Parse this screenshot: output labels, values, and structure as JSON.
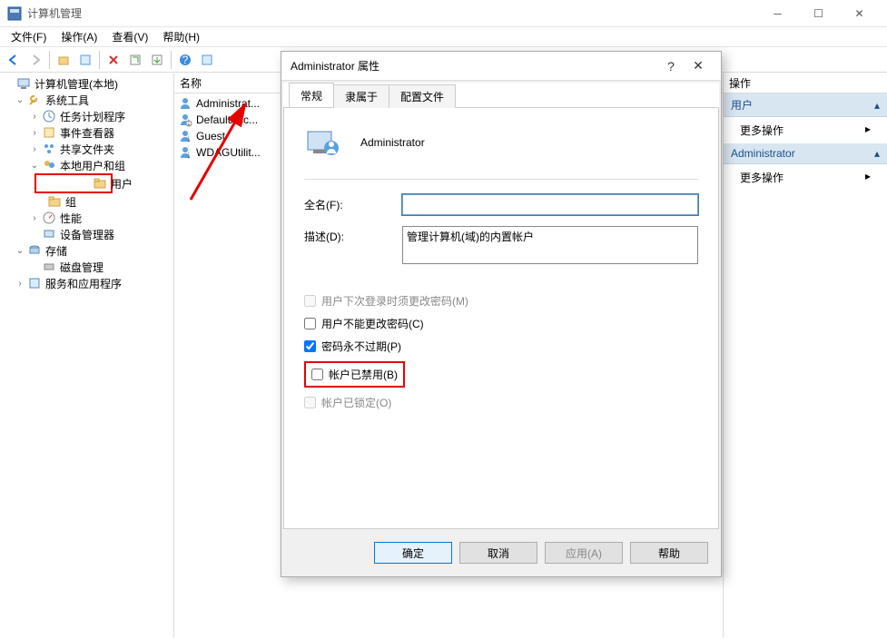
{
  "window": {
    "title": "计算机管理",
    "menus": [
      "文件(F)",
      "操作(A)",
      "查看(V)",
      "帮助(H)"
    ]
  },
  "tree": {
    "root": "计算机管理(本地)",
    "system_tools": "系统工具",
    "task_scheduler": "任务计划程序",
    "event_viewer": "事件查看器",
    "shared_folders": "共享文件夹",
    "local_users": "本地用户和组",
    "users": "用户",
    "groups": "组",
    "performance": "性能",
    "device_manager": "设备管理器",
    "storage": "存储",
    "disk_mgmt": "磁盘管理",
    "services_apps": "服务和应用程序"
  },
  "list": {
    "header_name": "名称",
    "items": [
      "Administrat...",
      "DefaultAcc...",
      "Guest",
      "WDAGUtilit..."
    ]
  },
  "actions": {
    "header": "操作",
    "section1": "用户",
    "more": "更多操作",
    "section2": "Administrator"
  },
  "dialog": {
    "title": "Administrator 属性",
    "tabs": [
      "常规",
      "隶属于",
      "配置文件"
    ],
    "username": "Administrator",
    "fullname_label": "全名(F):",
    "fullname_value": "",
    "desc_label": "描述(D):",
    "desc_value": "管理计算机(域)的内置帐户",
    "cb_must_change": "用户下次登录时须更改密码(M)",
    "cb_cannot_change": "用户不能更改密码(C)",
    "cb_never_expire": "密码永不过期(P)",
    "cb_disabled": "帐户已禁用(B)",
    "cb_locked": "帐户已锁定(O)",
    "btn_ok": "确定",
    "btn_cancel": "取消",
    "btn_apply": "应用(A)",
    "btn_help": "帮助"
  }
}
